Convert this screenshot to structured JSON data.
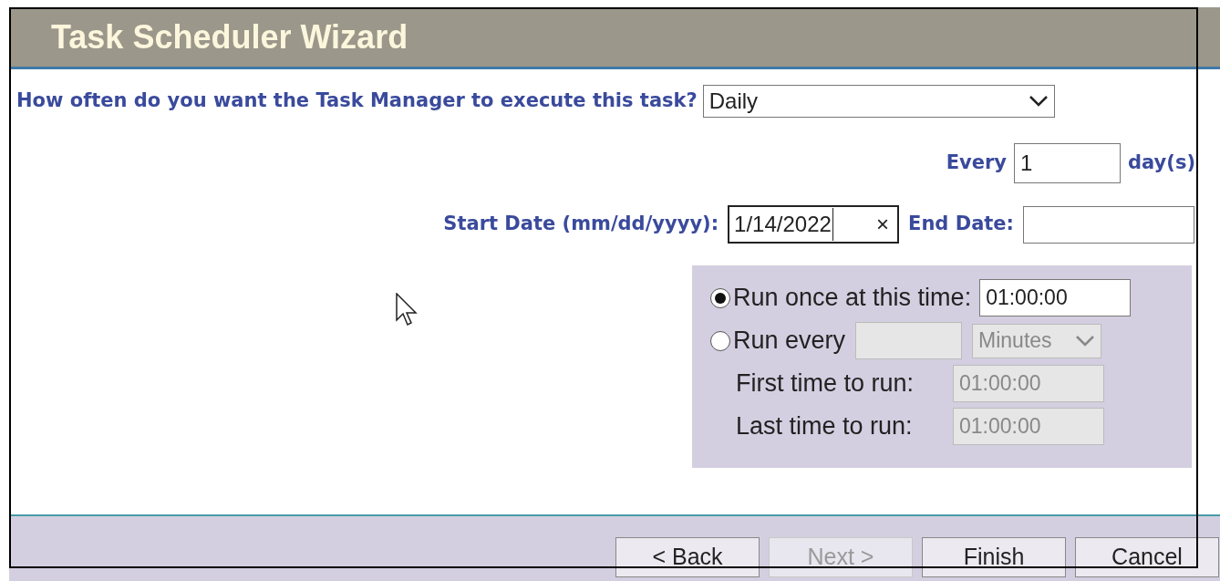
{
  "window": {
    "title": "Task Scheduler Wizard"
  },
  "frequency": {
    "label": "How often do you want the Task Manager to execute this task?",
    "value": "Daily"
  },
  "interval": {
    "label": "Every",
    "value": "1",
    "unit": "day(s)"
  },
  "dates": {
    "start_label": "Start Date (mm/dd/yyyy):",
    "start_value": "1/14/2022",
    "clear": "×",
    "end_label": "End Date:"
  },
  "schedule": [
    {
      "kind": "once",
      "label": "Run once at this time:",
      "selected": true,
      "value": "01:00:00"
    },
    {
      "kind": "repeat",
      "label": "Run every",
      "selected": false,
      "unit": "Minutes"
    }
  ],
  "range": [
    {
      "label": "First time to run:",
      "value": "01:00:00",
      "disabled": true
    },
    {
      "label": "Last time to run:",
      "value": "01:00:00",
      "disabled": true
    }
  ],
  "buttons": [
    {
      "label": "< Back",
      "disabled": false
    },
    {
      "label": "Next >",
      "disabled": true
    },
    {
      "label": "Finish",
      "disabled": false
    },
    {
      "label": "Cancel",
      "disabled": false
    }
  ]
}
